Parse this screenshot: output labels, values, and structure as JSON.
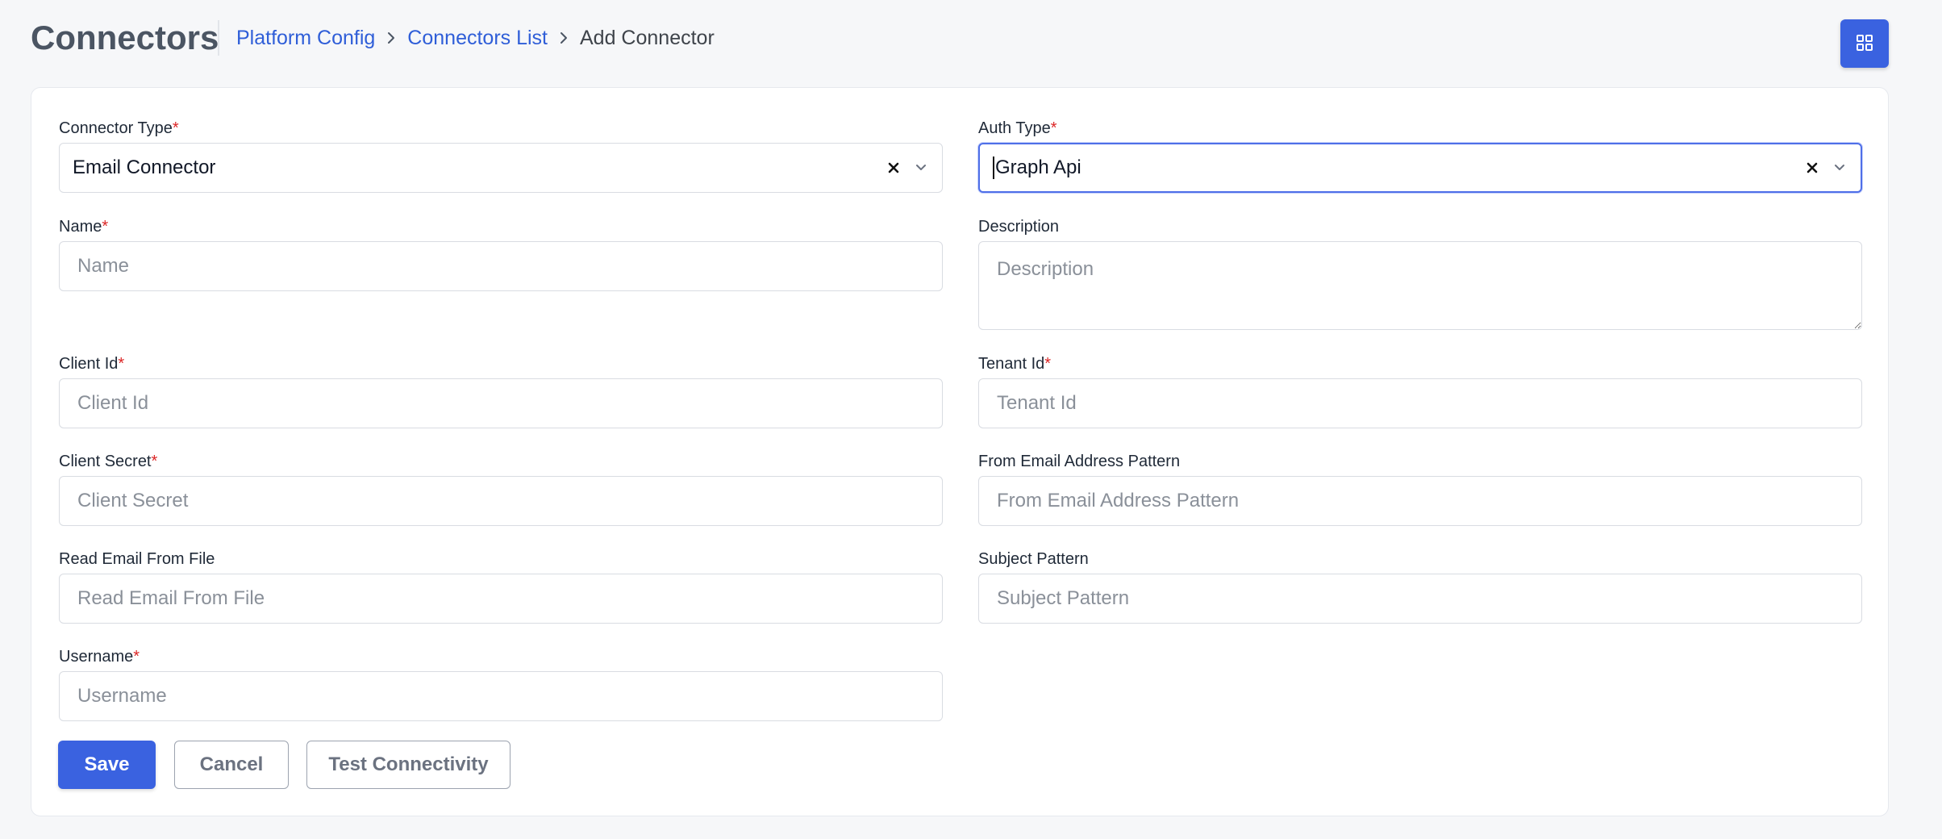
{
  "header": {
    "title": "Connectors",
    "breadcrumb": [
      {
        "label": "Platform Config",
        "link": true
      },
      {
        "label": "Connectors List",
        "link": true
      },
      {
        "label": "Add Connector",
        "link": false
      }
    ],
    "apps_icon": "grid-icon"
  },
  "form": {
    "connector_type": {
      "label": "Connector Type",
      "required": true,
      "value": "Email Connector"
    },
    "auth_type": {
      "label": "Auth Type",
      "required": true,
      "value": "Graph Api"
    },
    "name": {
      "label": "Name",
      "required": true,
      "placeholder": "Name",
      "value": ""
    },
    "description": {
      "label": "Description",
      "required": false,
      "placeholder": "Description",
      "value": ""
    },
    "client_id": {
      "label": "Client Id",
      "required": true,
      "placeholder": "Client Id",
      "value": ""
    },
    "tenant_id": {
      "label": "Tenant Id",
      "required": true,
      "placeholder": "Tenant Id",
      "value": ""
    },
    "client_secret": {
      "label": "Client Secret",
      "required": true,
      "placeholder": "Client Secret",
      "value": ""
    },
    "from_email_pattern": {
      "label": "From Email Address Pattern",
      "required": false,
      "placeholder": "From Email Address Pattern",
      "value": ""
    },
    "read_email_from_file": {
      "label": "Read Email From File",
      "required": false,
      "placeholder": "Read Email From File",
      "value": ""
    },
    "subject_pattern": {
      "label": "Subject Pattern",
      "required": false,
      "placeholder": "Subject Pattern",
      "value": ""
    },
    "username": {
      "label": "Username",
      "required": true,
      "placeholder": "Username",
      "value": ""
    },
    "required_mark": "*"
  },
  "actions": {
    "save": "Save",
    "cancel": "Cancel",
    "test": "Test Connectivity"
  },
  "colors": {
    "primary": "#3a62e0",
    "link": "#2f5ed8",
    "required": "#dc2626"
  }
}
